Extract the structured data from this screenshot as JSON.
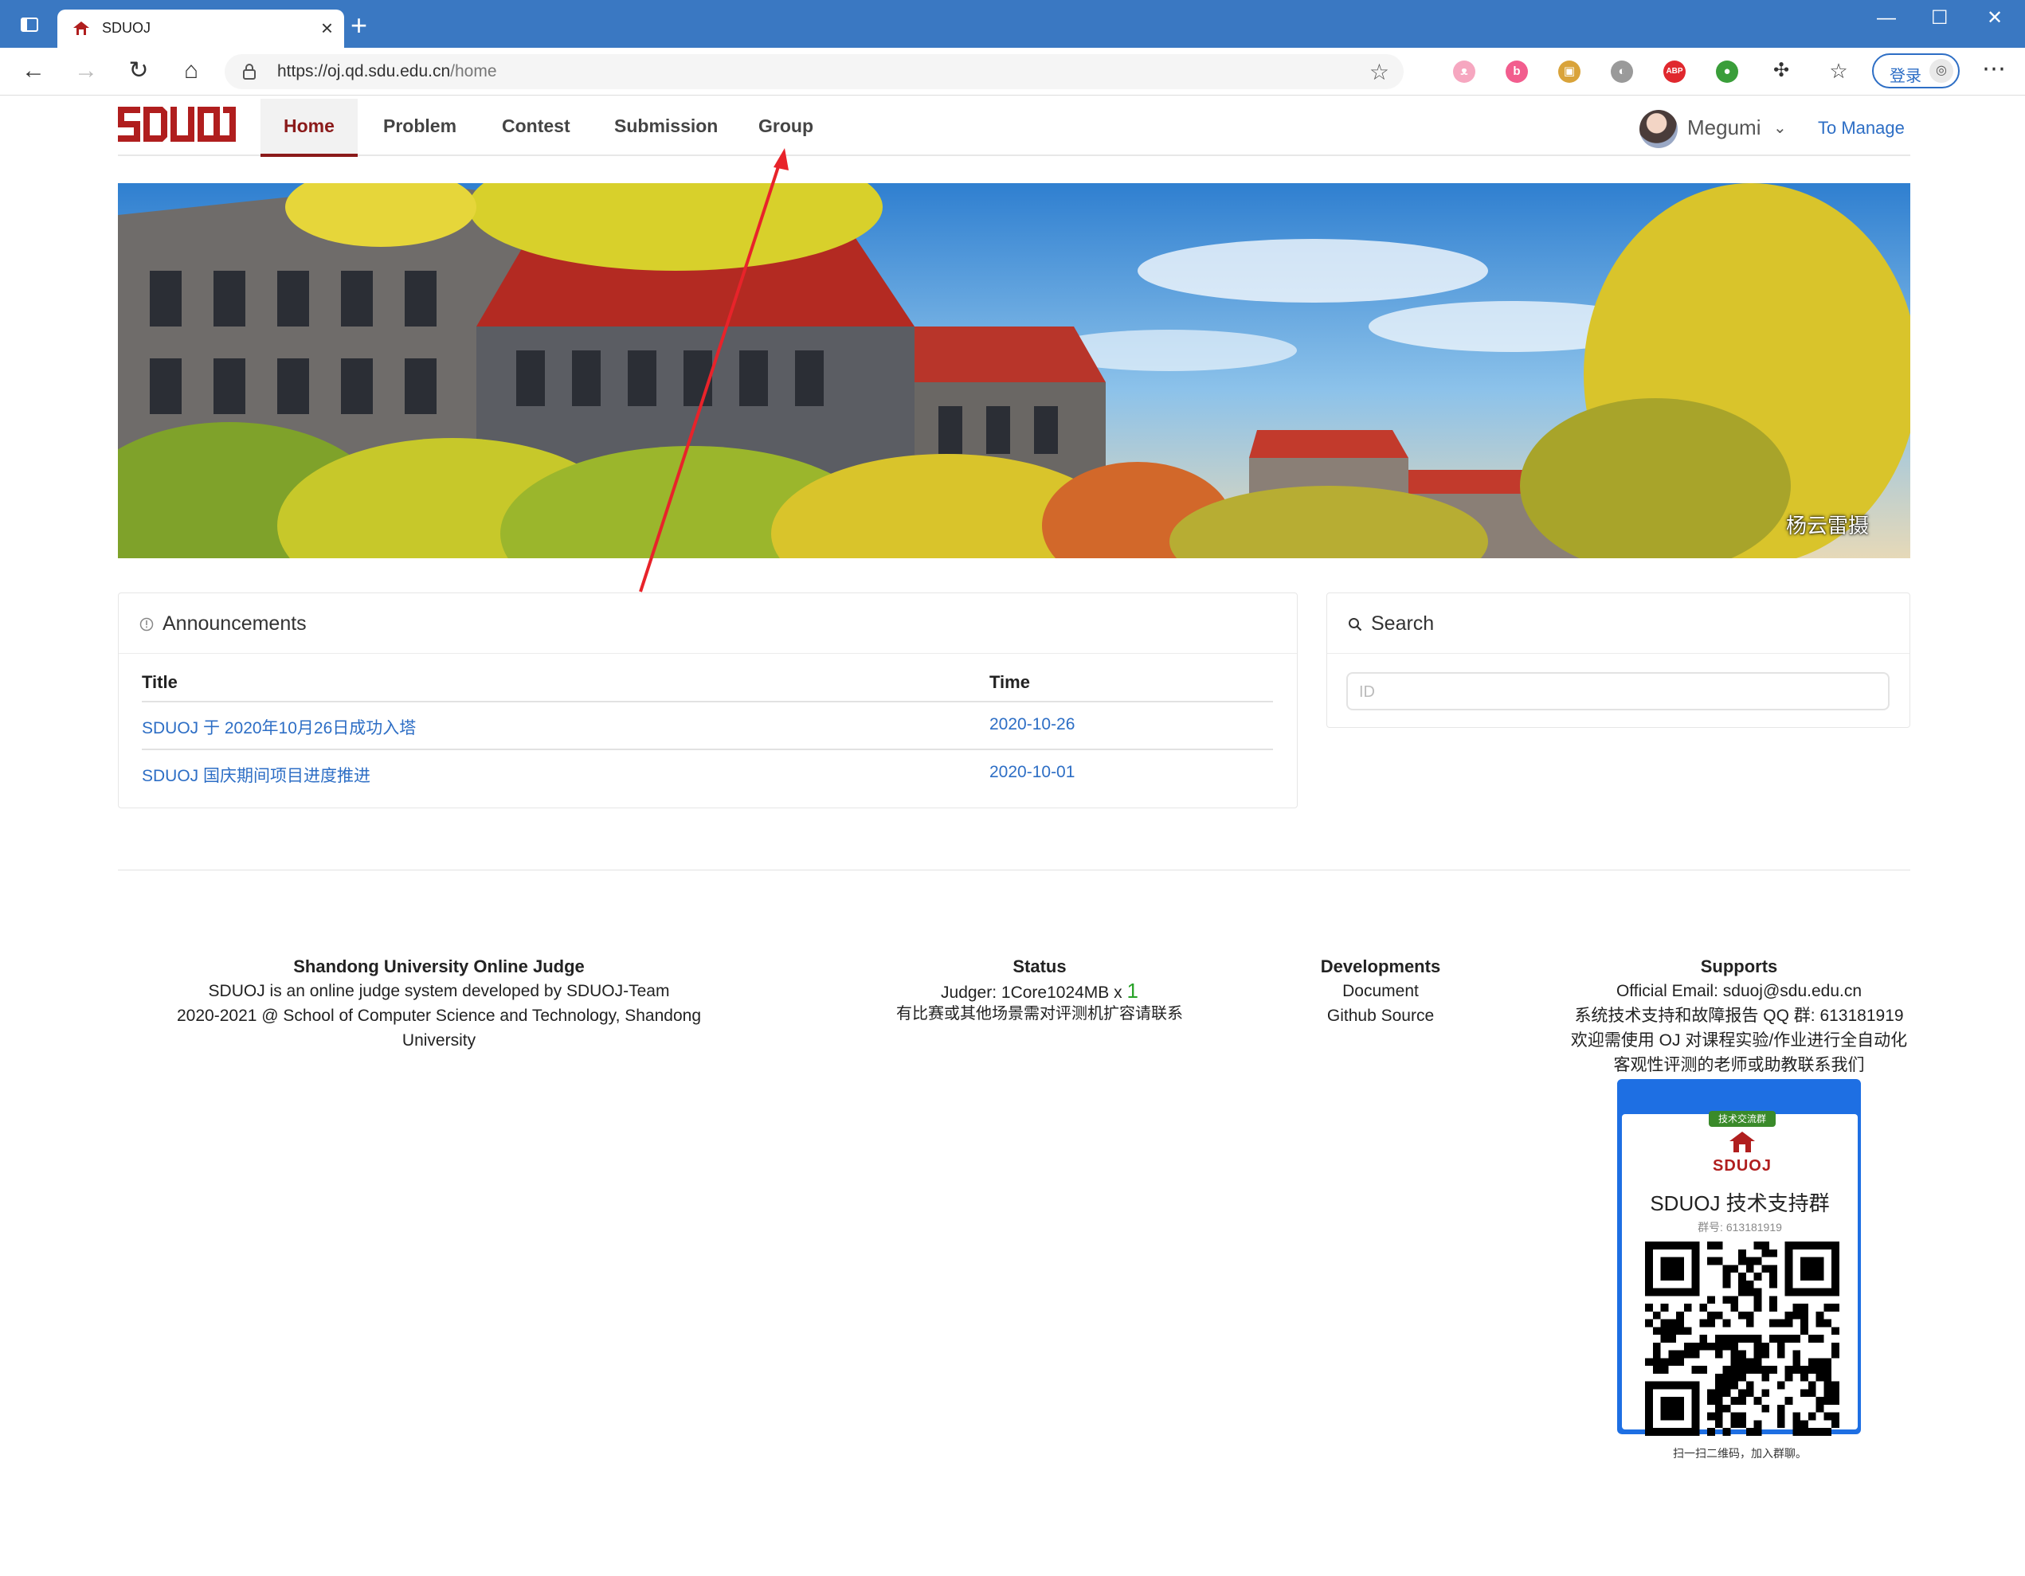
{
  "browser": {
    "tab_title": "SDUOJ",
    "close_tab": "×",
    "new_tab": "+",
    "url_domain": "https://oj.qd.sdu.edu.cn",
    "url_path": "/home",
    "login_label": "登录",
    "window_minimize": "—",
    "window_maximize": "☐",
    "window_close": "✕",
    "extensions": [
      {
        "name": "cat-extension-icon",
        "color": "#f6a7c0",
        "text": "ᴥ"
      },
      {
        "name": "bilibili-extension-icon",
        "color": "#f25d8e",
        "text": "b"
      },
      {
        "name": "image-extension-icon",
        "color": "#d9a33a",
        "text": "▣"
      },
      {
        "name": "grey-extension-icon",
        "color": "#9a9a9a",
        "text": "◐"
      },
      {
        "name": "adblock-extension-icon",
        "color": "#e0282e",
        "text": "ABP"
      },
      {
        "name": "globe-extension-icon",
        "color": "#3a9e3a",
        "text": "●"
      }
    ]
  },
  "site": {
    "logo_text": "SDUOJ",
    "nav": {
      "home": "Home",
      "problem": "Problem",
      "contest": "Contest",
      "submission": "Submission",
      "group": "Group"
    },
    "user_name": "Megumi",
    "to_manage": "To Manage",
    "banner_credit": "杨云雷摄",
    "accent_color": "#8b1a1a",
    "link_color": "#2d6ec5"
  },
  "announcements": {
    "title": "Announcements",
    "columns": [
      "Title",
      "Time"
    ],
    "rows": [
      {
        "title": "SDUOJ 于 2020年10月26日成功入塔",
        "time": "2020-10-26"
      },
      {
        "title": "SDUOJ 国庆期间项目进度推进",
        "time": "2020-10-01"
      }
    ]
  },
  "search": {
    "title": "Search",
    "placeholder": "ID"
  },
  "footer": {
    "about": {
      "heading": "Shandong University Online Judge",
      "line1": "SDUOJ is an online judge system developed by SDUOJ-Team",
      "line2": "2020-2021 @ School of Computer Science and Technology, Shandong",
      "line3": "University"
    },
    "status": {
      "heading": "Status",
      "judger_label": "Judger: 1Core1024MB x",
      "judger_count": "1",
      "note": "有比赛或其他场景需对评测机扩容请联系"
    },
    "developments": {
      "heading": "Developments",
      "document": "Document",
      "github": "Github Source"
    },
    "supports": {
      "heading": "Supports",
      "email": "Official Email: sduoj@sdu.edu.cn",
      "qq": "系统技术支持和故障报告 QQ 群: 613181919",
      "line3": "欢迎需使用 OJ 对课程实验/作业进行全自动化",
      "line4": "客观性评测的老师或助教联系我们"
    },
    "qr": {
      "banner": "技术交流群",
      "logo_text": "SDUOJ",
      "title": "SDUOJ 技术支持群",
      "group_no": "群号: 613181919",
      "foot": "扫一扫二维码，加入群聊。"
    }
  }
}
